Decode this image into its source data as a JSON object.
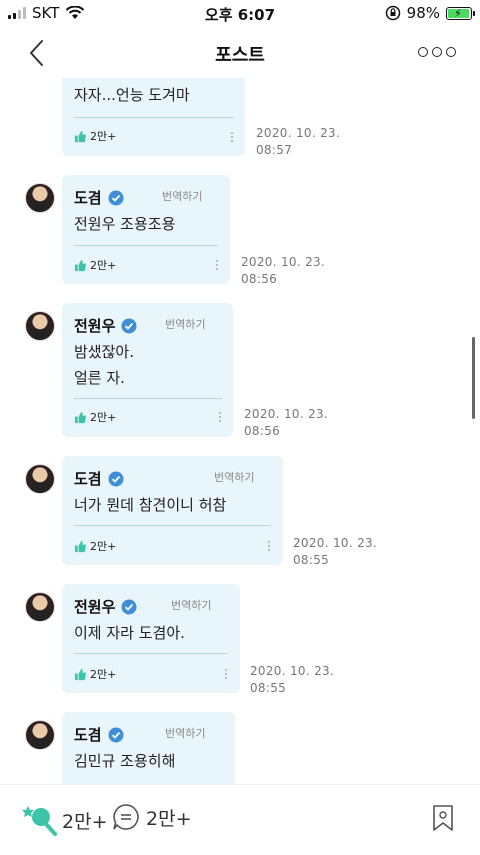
{
  "status": {
    "carrier": "SKT",
    "time": "오후 6:07",
    "battery": "98%",
    "battery_level": 0.98
  },
  "nav": {
    "title": "포스트"
  },
  "icons": {
    "back": "chevron-left-icon",
    "more": "more-horizontal-icon",
    "verified": "verified-badge-icon",
    "like": "thumbs-up-icon",
    "bubble_like": "light-stick-icon",
    "comment": "comment-icon",
    "bookmark": "bookmark-icon"
  },
  "colors": {
    "bubble": "#e8f5fb",
    "verified": "#3f8fd6",
    "like": "#3bc4a8",
    "divider": "#b8d5e0"
  },
  "translate_label": "번역하기",
  "comments": [
    {
      "text": "자자...언능 도겨마",
      "likes": "2만+",
      "date": "2020. 10. 23.",
      "time": "08:57"
    },
    {
      "name": "도겸",
      "text": "전원우 조용조용",
      "likes": "2만+",
      "date": "2020. 10. 23.",
      "time": "08:56"
    },
    {
      "name": "전원우",
      "text1": "밤샜잖아.",
      "text2": "얼른 자.",
      "likes": "2만+",
      "date": "2020. 10. 23.",
      "time": "08:56"
    },
    {
      "name": "도겸",
      "text": "너가 뭔데 참견이니 허참",
      "likes": "2만+",
      "date": "2020. 10. 23.",
      "time": "08:55"
    },
    {
      "name": "전원우",
      "text": "이제 자라 도겸아.",
      "likes": "2만+",
      "date": "2020. 10. 23.",
      "time": "08:55"
    },
    {
      "name": "도겸",
      "text": "김민규 조용히해"
    }
  ],
  "bottom": {
    "likes": "2만+",
    "comments": "2만+"
  }
}
